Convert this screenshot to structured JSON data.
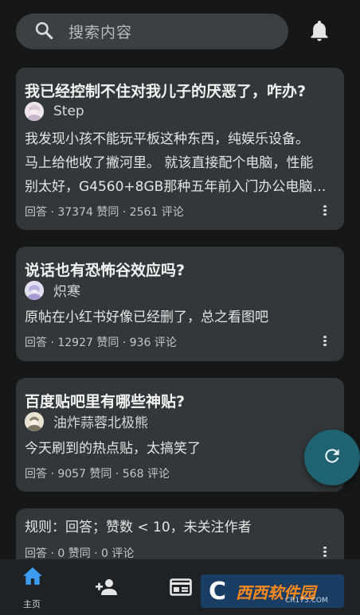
{
  "search": {
    "placeholder": "搜索内容",
    "icon": "search-icon"
  },
  "header": {
    "bell_icon": "bell-icon"
  },
  "cards": [
    {
      "title": "我已经控制不住对我儿子的厌恶了，咋办?",
      "author": "Step",
      "excerpt_lines": [
        "我发现小孩不能玩平板这种东西，纯娱乐设备。",
        "马上给他收了撇河里。 就该直接配个电脑，性能",
        "别太好，G4560+8GB那种五年前入门办公电脑…"
      ],
      "meta": "回答 · 37374 赞同 · 2561 评论"
    },
    {
      "title": "说话也有恐怖谷效应吗?",
      "author": "炽寒",
      "excerpt_lines": [
        "原帖在小红书好像已经删了，总之看图吧"
      ],
      "meta": "回答 · 12927 赞同 · 936 评论"
    },
    {
      "title": "百度贴吧里有哪些神贴?",
      "author": "油炸蒜蓉北极熊",
      "excerpt_lines": [
        "今天刷到的热点贴，太搞笑了"
      ],
      "meta": "回答 · 9057 赞同 · 568 评论"
    },
    {
      "excerpt_lines": [
        "规则：回答；赞数 < 10，未关注作者"
      ],
      "meta": "回答 · 0 赞同 · 0 评论"
    }
  ],
  "fab": {
    "icon": "refresh-icon"
  },
  "bottom_nav": {
    "home_label": "主页",
    "items": [
      "home-icon",
      "add-person-icon",
      "calendar-icon"
    ]
  },
  "watermark": {
    "brand": "西西软件园",
    "domain": "CR173.COM"
  },
  "colors": {
    "background": "#151718",
    "card": "#323739",
    "fab": "#1f6373",
    "accent": "#3d9cf0"
  }
}
